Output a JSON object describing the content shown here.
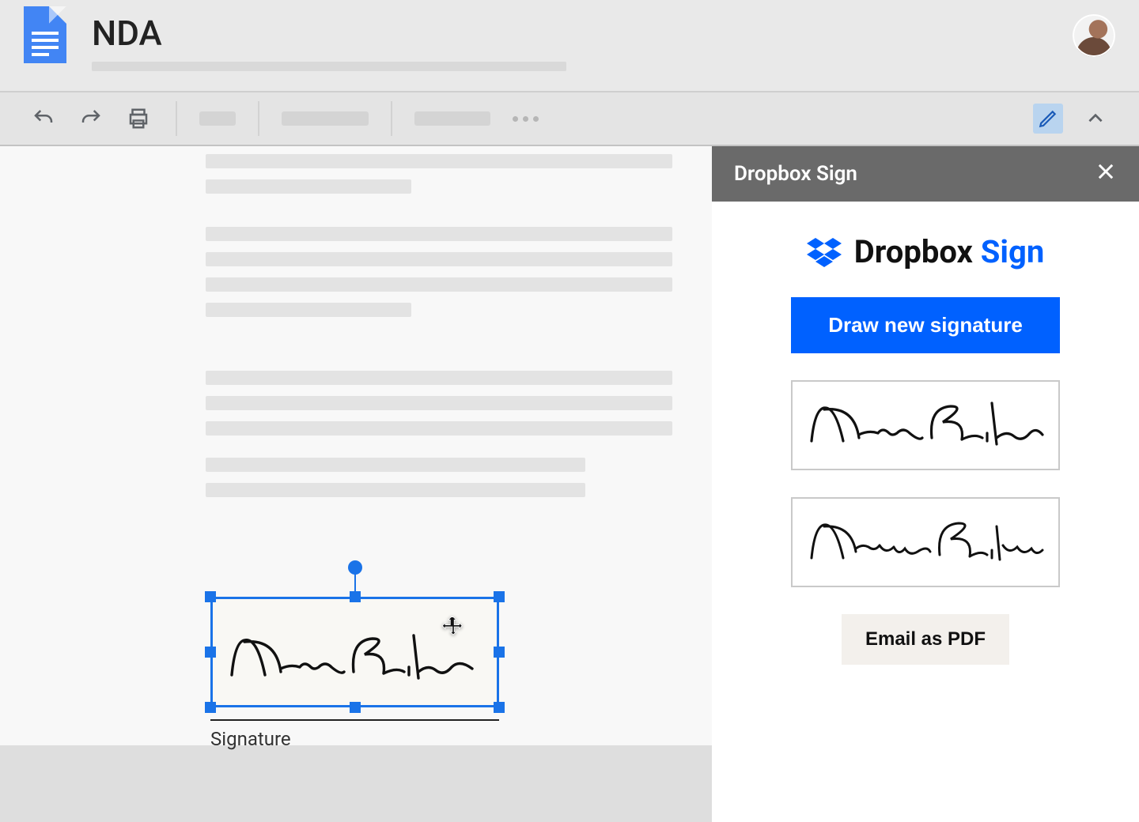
{
  "header": {
    "doc_title": "NDA"
  },
  "toolbar": {
    "undo_icon": "undo",
    "redo_icon": "redo",
    "print_icon": "print",
    "edit_icon": "pencil",
    "collapse_icon": "chevron-up"
  },
  "document": {
    "signature_label": "Signature"
  },
  "panel": {
    "title": "Dropbox Sign",
    "brand_word1": "Dropbox",
    "brand_word2": "Sign",
    "primary_button": "Draw new signature",
    "secondary_button": "Email as PDF",
    "signatures": [
      {
        "id": "sig-a"
      },
      {
        "id": "sig-b"
      }
    ]
  }
}
